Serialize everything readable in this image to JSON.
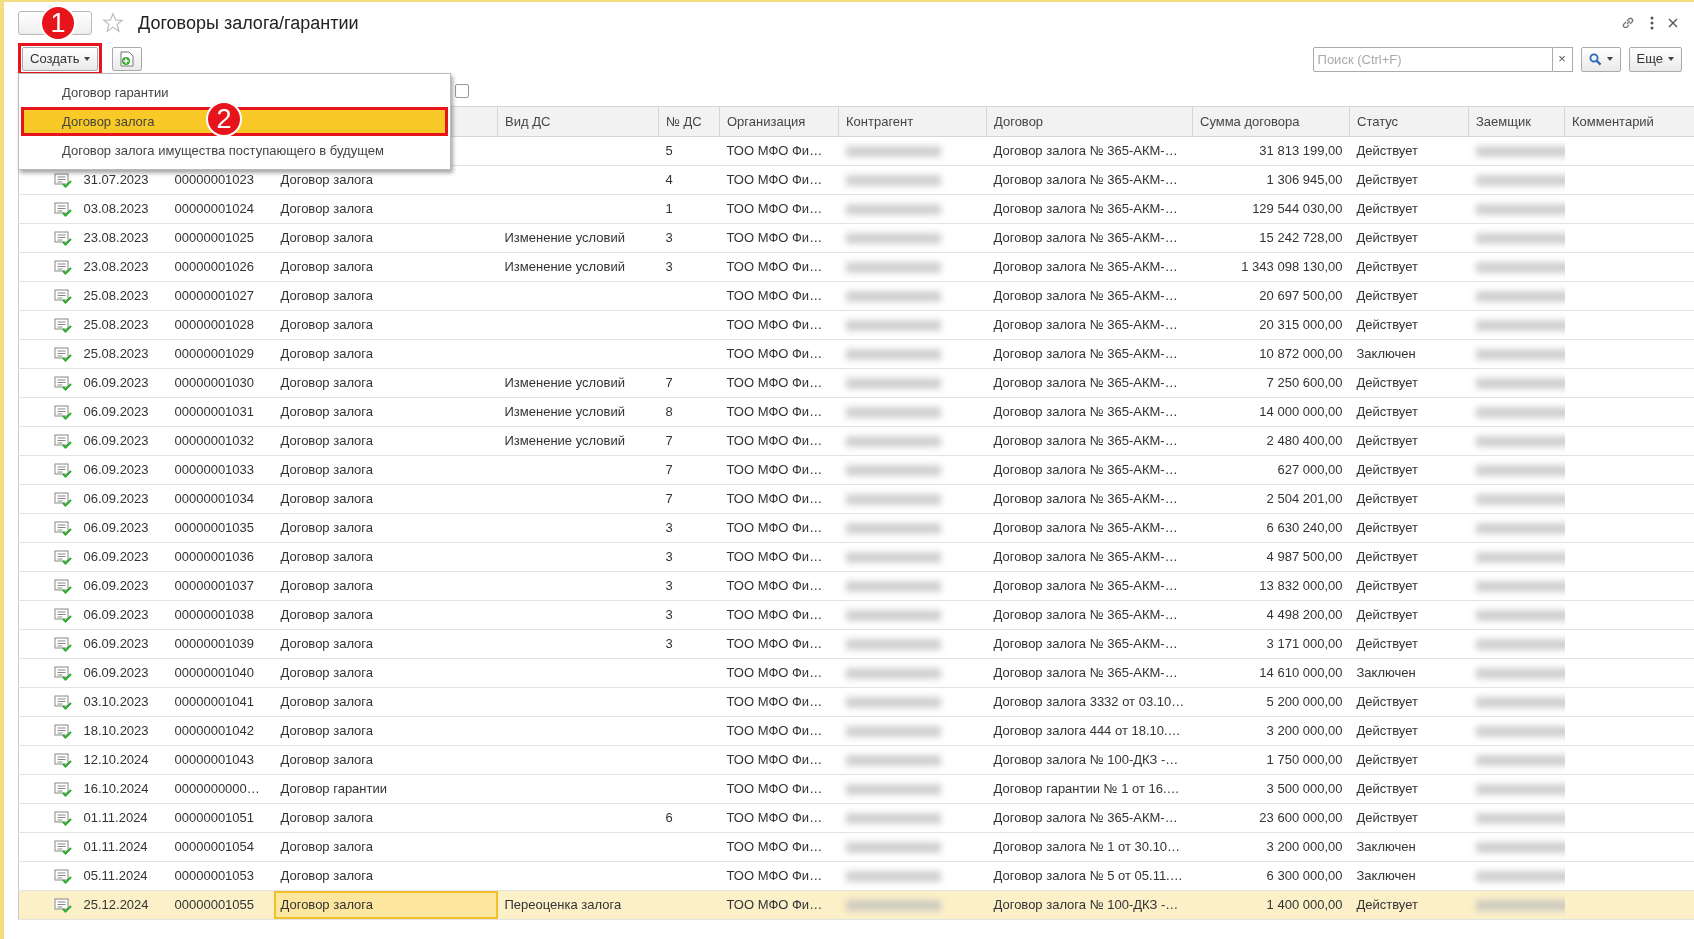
{
  "window": {
    "title": "Договоры залога/гарантии"
  },
  "toolbar": {
    "create_button": "Создать",
    "search": {
      "placeholder": "Поиск (Ctrl+F)"
    },
    "clear_button": "×",
    "more_button": "Еще"
  },
  "create_menu": [
    {
      "label": "Договор гарантии",
      "selected": false
    },
    {
      "label": "Договор залога",
      "selected": true
    },
    {
      "label": "Договор залога имущества поступающего в будущем",
      "selected": false
    }
  ],
  "callouts": [
    "1",
    "2"
  ],
  "filter_checkbox": {
    "checked": false
  },
  "table": {
    "columns": [
      "Вид ДС",
      "№ ДС",
      "Организация",
      "Контрагент",
      "Договор",
      "Сумма договора",
      "Статус",
      "Заемщик",
      "Комментарий"
    ],
    "rows": [
      {
        "n_ds": "5",
        "org": "ТОО МФО Фи…",
        "contract": "Договор залога № 365-АКМ-…",
        "sum": "31 813 199,00",
        "status": "Действует",
        "selected": false
      },
      {
        "date": "31.07.2023",
        "number": "00000001023",
        "type": "Договор залога",
        "n_ds": "4",
        "org": "ТОО МФО Фи…",
        "contract": "Договор залога № 365-АКМ-…",
        "sum": "1 306 945,00",
        "status": "Действует",
        "selected": false
      },
      {
        "date": "03.08.2023",
        "number": "00000001024",
        "type": "Договор залога",
        "n_ds": "1",
        "org": "ТОО МФО Фи…",
        "contract": "Договор залога № 365-АКМ-…",
        "sum": "129 544 030,00",
        "status": "Действует",
        "selected": false
      },
      {
        "date": "23.08.2023",
        "number": "00000001025",
        "type": "Договор залога",
        "vid_ds": "Изменение условий",
        "n_ds": "3",
        "org": "ТОО МФО Фи…",
        "contract": "Договор залога № 365-АКМ-…",
        "sum": "15 242 728,00",
        "status": "Действует",
        "selected": false
      },
      {
        "date": "23.08.2023",
        "number": "00000001026",
        "type": "Договор залога",
        "vid_ds": "Изменение условий",
        "n_ds": "3",
        "org": "ТОО МФО Фи…",
        "contract": "Договор залога № 365-АКМ-…",
        "sum": "1 343 098 130,00",
        "status": "Действует",
        "selected": false
      },
      {
        "date": "25.08.2023",
        "number": "00000001027",
        "type": "Договор залога",
        "org": "ТОО МФО Фи…",
        "contract": "Договор залога № 365-АКМ-…",
        "sum": "20 697 500,00",
        "status": "Действует",
        "selected": false
      },
      {
        "date": "25.08.2023",
        "number": "00000001028",
        "type": "Договор залога",
        "org": "ТОО МФО Фи…",
        "contract": "Договор залога № 365-АКМ-…",
        "sum": "20 315 000,00",
        "status": "Действует",
        "selected": false
      },
      {
        "date": "25.08.2023",
        "number": "00000001029",
        "type": "Договор залога",
        "org": "ТОО МФО Фи…",
        "contract": "Договор залога № 365-АКМ-…",
        "sum": "10 872 000,00",
        "status": "Заключен",
        "selected": false
      },
      {
        "date": "06.09.2023",
        "number": "00000001030",
        "type": "Договор залога",
        "vid_ds": "Изменение условий",
        "n_ds": "7",
        "org": "ТОО МФО Фи…",
        "contract": "Договор залога № 365-АКМ-…",
        "sum": "7 250 600,00",
        "status": "Действует",
        "selected": false
      },
      {
        "date": "06.09.2023",
        "number": "00000001031",
        "type": "Договор залога",
        "vid_ds": "Изменение условий",
        "n_ds": "8",
        "org": "ТОО МФО Фи…",
        "contract": "Договор залога № 365-АКМ-…",
        "sum": "14 000 000,00",
        "status": "Действует",
        "selected": false
      },
      {
        "date": "06.09.2023",
        "number": "00000001032",
        "type": "Договор залога",
        "vid_ds": "Изменение условий",
        "n_ds": "7",
        "org": "ТОО МФО Фи…",
        "contract": "Договор залога № 365-АКМ-…",
        "sum": "2 480 400,00",
        "status": "Действует",
        "selected": false
      },
      {
        "date": "06.09.2023",
        "number": "00000001033",
        "type": "Договор залога",
        "n_ds": "7",
        "org": "ТОО МФО Фи…",
        "contract": "Договор залога № 365-АКМ-…",
        "sum": "627 000,00",
        "status": "Действует",
        "selected": false
      },
      {
        "date": "06.09.2023",
        "number": "00000001034",
        "type": "Договор залога",
        "n_ds": "7",
        "org": "ТОО МФО Фи…",
        "contract": "Договор залога № 365-АКМ-…",
        "sum": "2 504 201,00",
        "status": "Действует",
        "selected": false
      },
      {
        "date": "06.09.2023",
        "number": "00000001035",
        "type": "Договор залога",
        "n_ds": "3",
        "org": "ТОО МФО Фи…",
        "contract": "Договор залога № 365-АКМ-…",
        "sum": "6 630 240,00",
        "status": "Действует",
        "selected": false
      },
      {
        "date": "06.09.2023",
        "number": "00000001036",
        "type": "Договор залога",
        "n_ds": "3",
        "org": "ТОО МФО Фи…",
        "contract": "Договор залога № 365-АКМ-…",
        "sum": "4 987 500,00",
        "status": "Действует",
        "selected": false
      },
      {
        "date": "06.09.2023",
        "number": "00000001037",
        "type": "Договор залога",
        "n_ds": "3",
        "org": "ТОО МФО Фи…",
        "contract": "Договор залога № 365-АКМ-…",
        "sum": "13 832 000,00",
        "status": "Действует",
        "selected": false
      },
      {
        "date": "06.09.2023",
        "number": "00000001038",
        "type": "Договор залога",
        "n_ds": "3",
        "org": "ТОО МФО Фи…",
        "contract": "Договор залога № 365-АКМ-…",
        "sum": "4 498 200,00",
        "status": "Действует",
        "selected": false
      },
      {
        "date": "06.09.2023",
        "number": "00000001039",
        "type": "Договор залога",
        "n_ds": "3",
        "org": "ТОО МФО Фи…",
        "contract": "Договор залога № 365-АКМ-…",
        "sum": "3 171 000,00",
        "status": "Действует",
        "selected": false
      },
      {
        "date": "06.09.2023",
        "number": "00000001040",
        "type": "Договор залога",
        "org": "ТОО МФО Фи…",
        "contract": "Договор залога № 365-АКМ-…",
        "sum": "14 610 000,00",
        "status": "Заключен",
        "selected": false
      },
      {
        "date": "03.10.2023",
        "number": "00000001041",
        "type": "Договор залога",
        "org": "ТОО МФО Фи…",
        "contract": "Договор залога 3332 от 03.10…",
        "sum": "5 200 000,00",
        "status": "Действует",
        "selected": false
      },
      {
        "date": "18.10.2023",
        "number": "00000001042",
        "type": "Договор залога",
        "org": "ТОО МФО Фи…",
        "contract": "Договор залога 444 от 18.10.…",
        "sum": "3 200 000,00",
        "status": "Действует",
        "selected": false
      },
      {
        "date": "12.10.2024",
        "number": "00000001043",
        "type": "Договор залога",
        "org": "ТОО МФО Фи…",
        "contract": "Договор залога № 100-ДКЗ -…",
        "sum": "1 750 000,00",
        "status": "Действует",
        "selected": false
      },
      {
        "date": "16.10.2024",
        "number": "0000000000…",
        "type": "Договор гарантии",
        "org": "ТОО МФО Фи…",
        "contract": "Договор гарантии № 1 от 16.…",
        "sum": "3 500 000,00",
        "status": "Действует",
        "selected": false
      },
      {
        "date": "01.11.2024",
        "number": "00000001051",
        "type": "Договор залога",
        "n_ds": "6",
        "org": "ТОО МФО Фи…",
        "contract": "Договор залога № 365-АКМ-…",
        "sum": "23 600 000,00",
        "status": "Действует",
        "selected": false
      },
      {
        "date": "01.11.2024",
        "number": "00000001054",
        "type": "Договор залога",
        "org": "ТОО МФО Фи…",
        "contract": "Договор залога № 1 от 30.10…",
        "sum": "3 200 000,00",
        "status": "Заключен",
        "selected": false
      },
      {
        "date": "05.11.2024",
        "number": "00000001053",
        "type": "Договор залога",
        "org": "ТОО МФО Фи…",
        "contract": "Договор залога № 5 от 05.11.…",
        "sum": "6 300 000,00",
        "status": "Заключен",
        "selected": false
      },
      {
        "date": "25.12.2024",
        "number": "00000001055",
        "type": "Договор залога",
        "vid_ds": "Переоценка залога",
        "org": "ТОО МФО Фи…",
        "contract": "Договор залога № 100-ДКЗ -…",
        "sum": "1 400 000,00",
        "status": "Действует",
        "selected": true
      }
    ]
  }
}
